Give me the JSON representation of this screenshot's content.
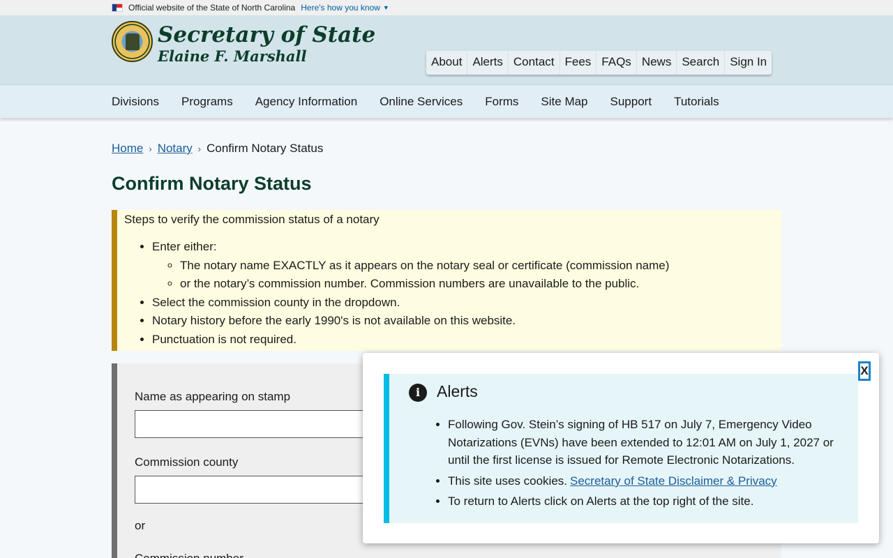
{
  "gov_banner": {
    "official_text": "Official website of the State of North Carolina",
    "how_link": "Here's how you know"
  },
  "header": {
    "title": "Secretary of State",
    "subtitle": "Elaine F. Marshall",
    "util_nav": [
      "About",
      "Alerts",
      "Contact",
      "Fees",
      "FAQs",
      "News",
      "Search",
      "Sign In"
    ]
  },
  "main_nav": [
    "Divisions",
    "Programs",
    "Agency Information",
    "Online Services",
    "Forms",
    "Site Map",
    "Support",
    "Tutorials"
  ],
  "breadcrumb": {
    "home": "Home",
    "notary": "Notary",
    "current": "Confirm Notary Status"
  },
  "page_title": "Confirm Notary Status",
  "info_box": {
    "intro": "Steps to verify the commission status of a notary",
    "item1": "Enter either:",
    "sub1": "The notary name EXACTLY as it appears on the notary seal or certificate (commission name)",
    "sub2": "or the notary’s commission number. Commission numbers are unavailable to the public.",
    "item2": "Select the commission county in the dropdown.",
    "item3": "Notary history before the early 1990's is not available on this website.",
    "item4": "Punctuation is not required."
  },
  "form": {
    "name_label": "Name as appearing on stamp",
    "county_label": "Commission county",
    "or_text": "or",
    "number_label": "Commission number"
  },
  "alert_modal": {
    "close_label": "X",
    "heading": "Alerts",
    "item1": "Following Gov. Stein’s signing of HB 517 on July 7, Emergency Video Notarizations (EVNs) have been extended to 12:01 AM on July 1, 2027 or until the first license is issued for Remote Electronic Notarizations.",
    "item2_text": "This site uses cookies.",
    "item2_link": "Secretary of State Disclaimer & Privacy",
    "item3": "To return to Alerts click on Alerts at the top right of the site."
  }
}
